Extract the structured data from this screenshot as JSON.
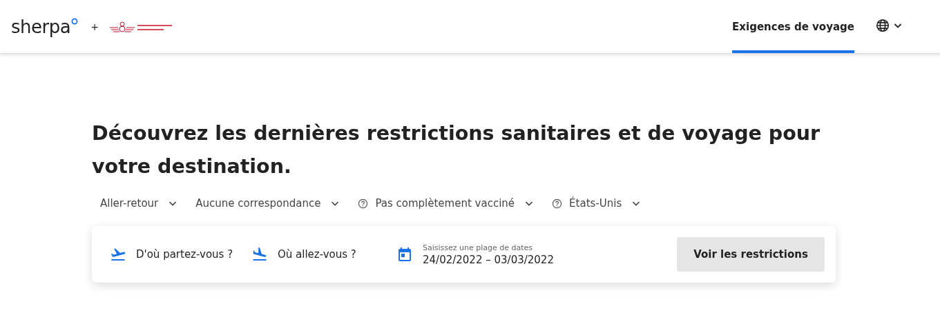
{
  "header": {
    "brand": "sherpa",
    "plus": "+",
    "nav": [
      {
        "label": "Exigences de voyage",
        "selected": true
      }
    ]
  },
  "headline": "Découvrez les dernières restrictions sanitaires et de voyage pour votre destination.",
  "filters": [
    {
      "label": "Aller-retour",
      "help": false
    },
    {
      "label": "Aucune correspondance",
      "help": false
    },
    {
      "label": "Pas complètement vacciné",
      "help": true
    },
    {
      "label": "États-Unis",
      "help": true
    }
  ],
  "search": {
    "origin": {
      "placeholder": "D'où partez-vous ?"
    },
    "destination": {
      "placeholder": "Où allez-vous ?"
    },
    "dates": {
      "label": "Saisissez une plage de dates",
      "start": "24/02/2022",
      "separator": "–",
      "end": "03/03/2022"
    },
    "button": "Voir les restrictions"
  }
}
